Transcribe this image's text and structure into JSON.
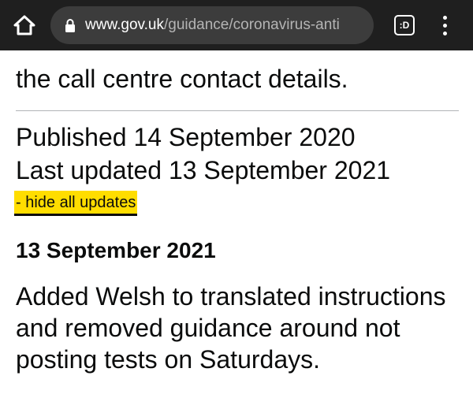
{
  "browser": {
    "url_domain": "www.gov.uk",
    "url_path": "/guidance/coronavirus-anti",
    "tab_button_label": ":D"
  },
  "content": {
    "partial_previous_line": "",
    "contact_text": "the call centre contact details.",
    "published": "Published 14 September 2020",
    "last_updated": "Last updated 13 September 2021",
    "hide_updates_link": "- hide all updates",
    "updates": [
      {
        "date": "13 September 2021",
        "text": "Added Welsh to translated instructions and removed guidance around not posting tests on Saturdays."
      }
    ]
  },
  "colors": {
    "browser_bar": "#1f1f1f",
    "url_box": "#3c3c3c",
    "link_focus_yellow": "#ffdd00",
    "text": "#0b0c0c",
    "divider": "#b1b4b6"
  }
}
